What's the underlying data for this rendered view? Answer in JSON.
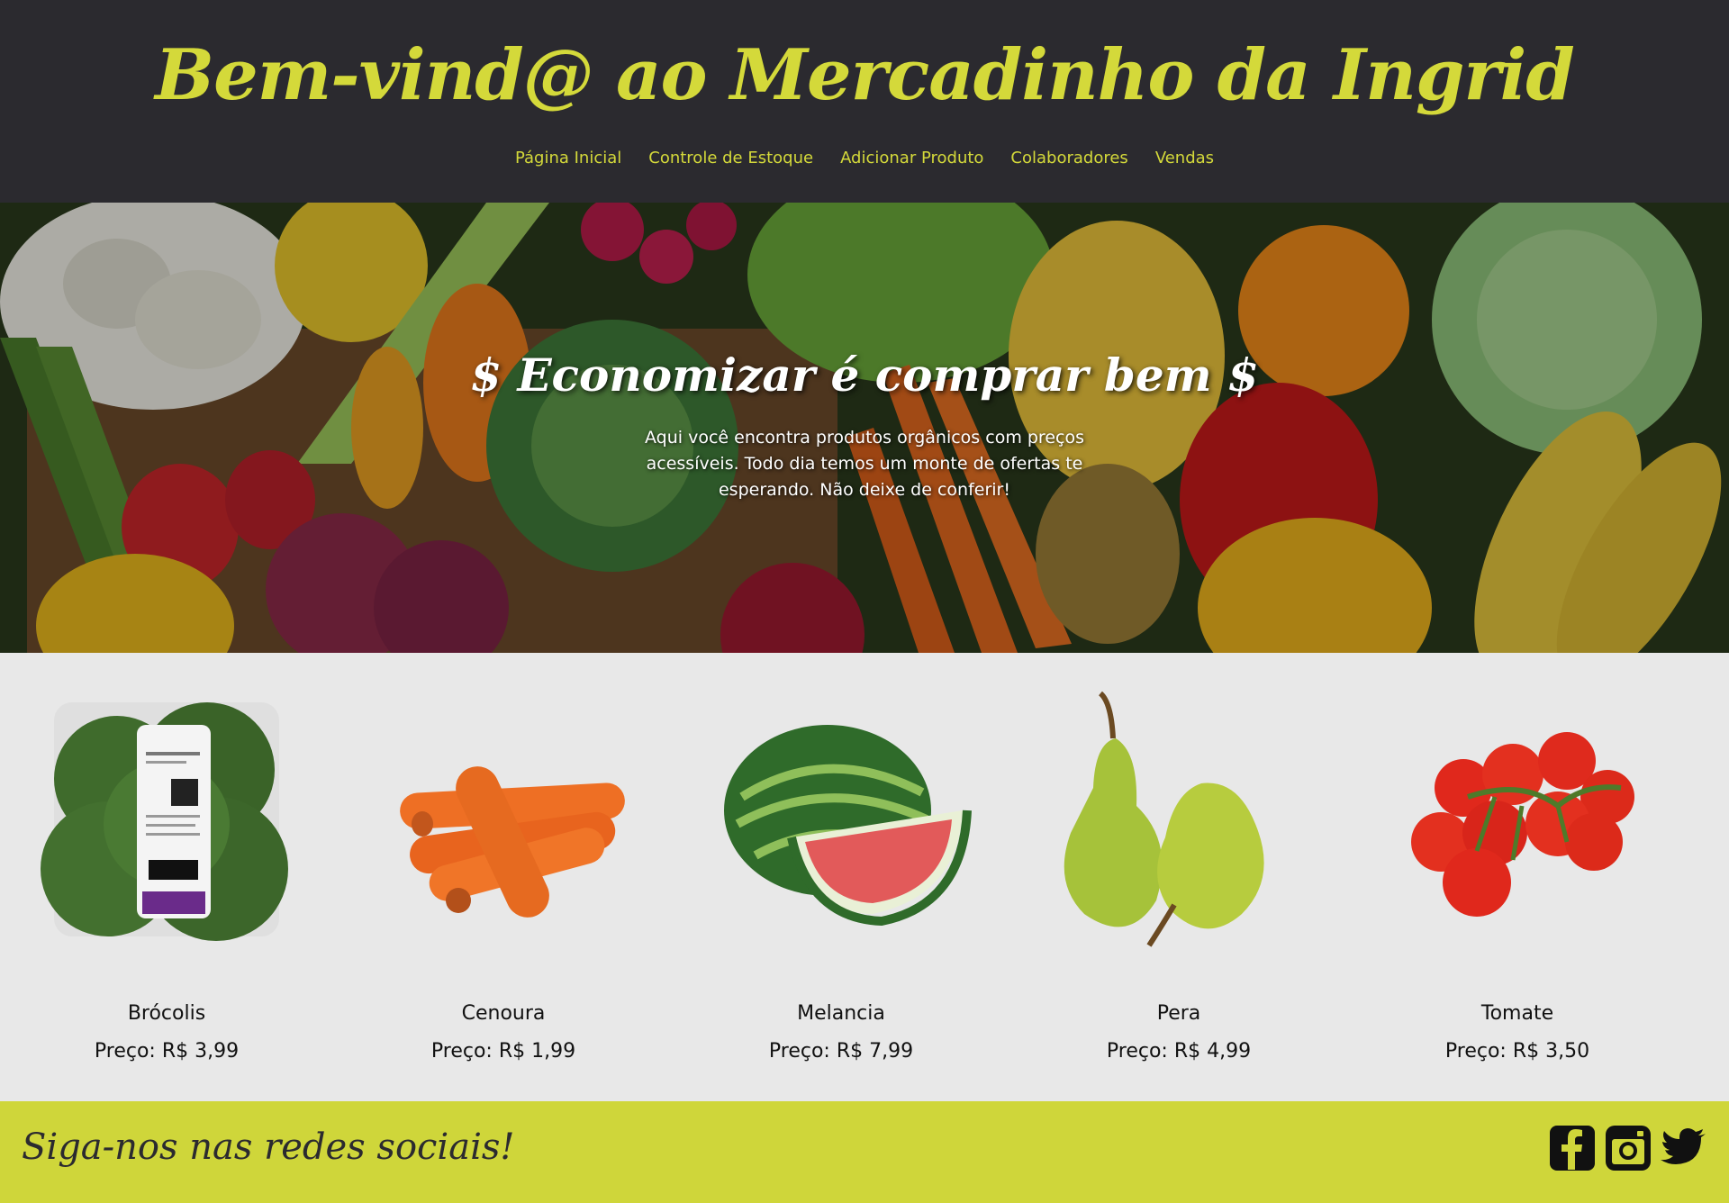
{
  "header": {
    "title": "Bem-vind@ ao Mercadinho da Ingrid",
    "nav": [
      {
        "label": "Página Inicial"
      },
      {
        "label": "Controle de Estoque"
      },
      {
        "label": "Adicionar Produto"
      },
      {
        "label": "Colaboradores"
      },
      {
        "label": "Vendas"
      }
    ]
  },
  "hero": {
    "title": "$ Economizar é comprar bem $",
    "description": "Aqui você encontra produtos orgânicos com preços acessíveis. Todo dia temos um monte de ofertas te esperando. Não deixe de conferir!"
  },
  "products": [
    {
      "name": "Brócolis",
      "price": "Preço: R$ 3,99",
      "icon": "broccoli-image"
    },
    {
      "name": "Cenoura",
      "price": "Preço: R$ 1,99",
      "icon": "carrot-image"
    },
    {
      "name": "Melancia",
      "price": "Preço: R$ 7,99",
      "icon": "watermelon-image"
    },
    {
      "name": "Pera",
      "price": "Preço: R$ 4,99",
      "icon": "pear-image"
    },
    {
      "name": "Tomate",
      "price": "Preço: R$ 3,50",
      "icon": "tomato-image"
    }
  ],
  "footer": {
    "text": "Siga-nos nas redes sociais!",
    "social": [
      "facebook-icon",
      "instagram-icon",
      "twitter-icon"
    ]
  },
  "colors": {
    "header_bg": "#2b2a2f",
    "accent": "#d4d93a",
    "footer_bg": "#cfd63a",
    "products_bg": "#e8e8e8"
  }
}
